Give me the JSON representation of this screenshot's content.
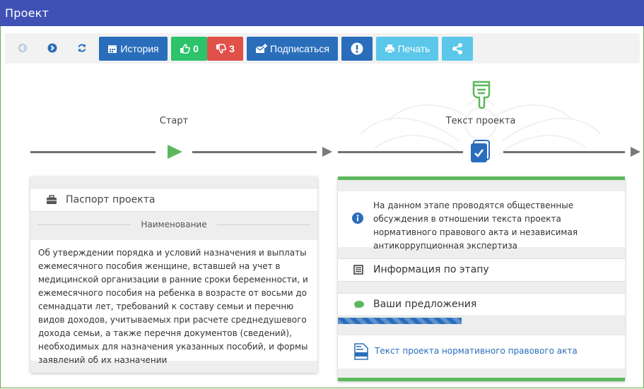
{
  "window": {
    "title": "Проект"
  },
  "toolbar": {
    "history_label": "История",
    "likes_count": "0",
    "dislikes_count": "3",
    "subscribe_label": "Подписаться",
    "print_label": "Печать"
  },
  "timeline": {
    "stages": [
      {
        "label": "Старт"
      },
      {
        "label": "Текст проекта"
      }
    ]
  },
  "passport": {
    "header": "Паспорт проекта",
    "section_title": "Наименование",
    "description": "Об утверждении порядка и условий назначения и выплаты ежемесячного пособия женщине, вставшей на учет в медицинской организации в ранние сроки беременности, и ежемесячного пособия на ребенка в возрасте от восьми до семнадцати лет, требований к составу семьи и перечню видов доходов, учитываемых при расчете среднедушевого дохода семьи, а также перечня документов (сведений), необходимых для назначения указанных пособий, и формы заявлений об их назначении"
  },
  "stage_panel": {
    "info_text": "На данном этапе проводятся общественные обсуждения в отношении текста проекта нормативного правового акта и независимая антикоррупционная экспертиза",
    "stage_info_label": "Информация по этапу",
    "proposals_label": "Ваши предложения",
    "progress_fraction": 0.43,
    "document_link": "Текст проекта нормативного правового акта"
  },
  "colors": {
    "title_bar": "#3f51b5",
    "accent_blue": "#2a6ebb",
    "like_green": "#2cc36b",
    "dislike_red": "#e0514a",
    "light_blue": "#5bc7e9",
    "stage_green": "#5cb85c"
  },
  "icons": {
    "back": "arrow-left-circle-icon",
    "forward": "arrow-right-circle-icon",
    "refresh": "refresh-icon",
    "history": "calendar-icon",
    "like": "thumbs-up-icon",
    "dislike": "thumbs-down-icon",
    "subscribe": "envelope-plus-icon",
    "report": "exclamation-circle-icon",
    "print": "printer-icon",
    "share": "share-icon",
    "start": "play-icon",
    "stage": "pointing-hand-icon",
    "stage_marker": "document-check-icon",
    "passport": "briefcase-icon",
    "info": "info-circle-icon",
    "stage_info": "list-icon",
    "proposals": "comment-icon",
    "document": "docx-file-icon"
  }
}
